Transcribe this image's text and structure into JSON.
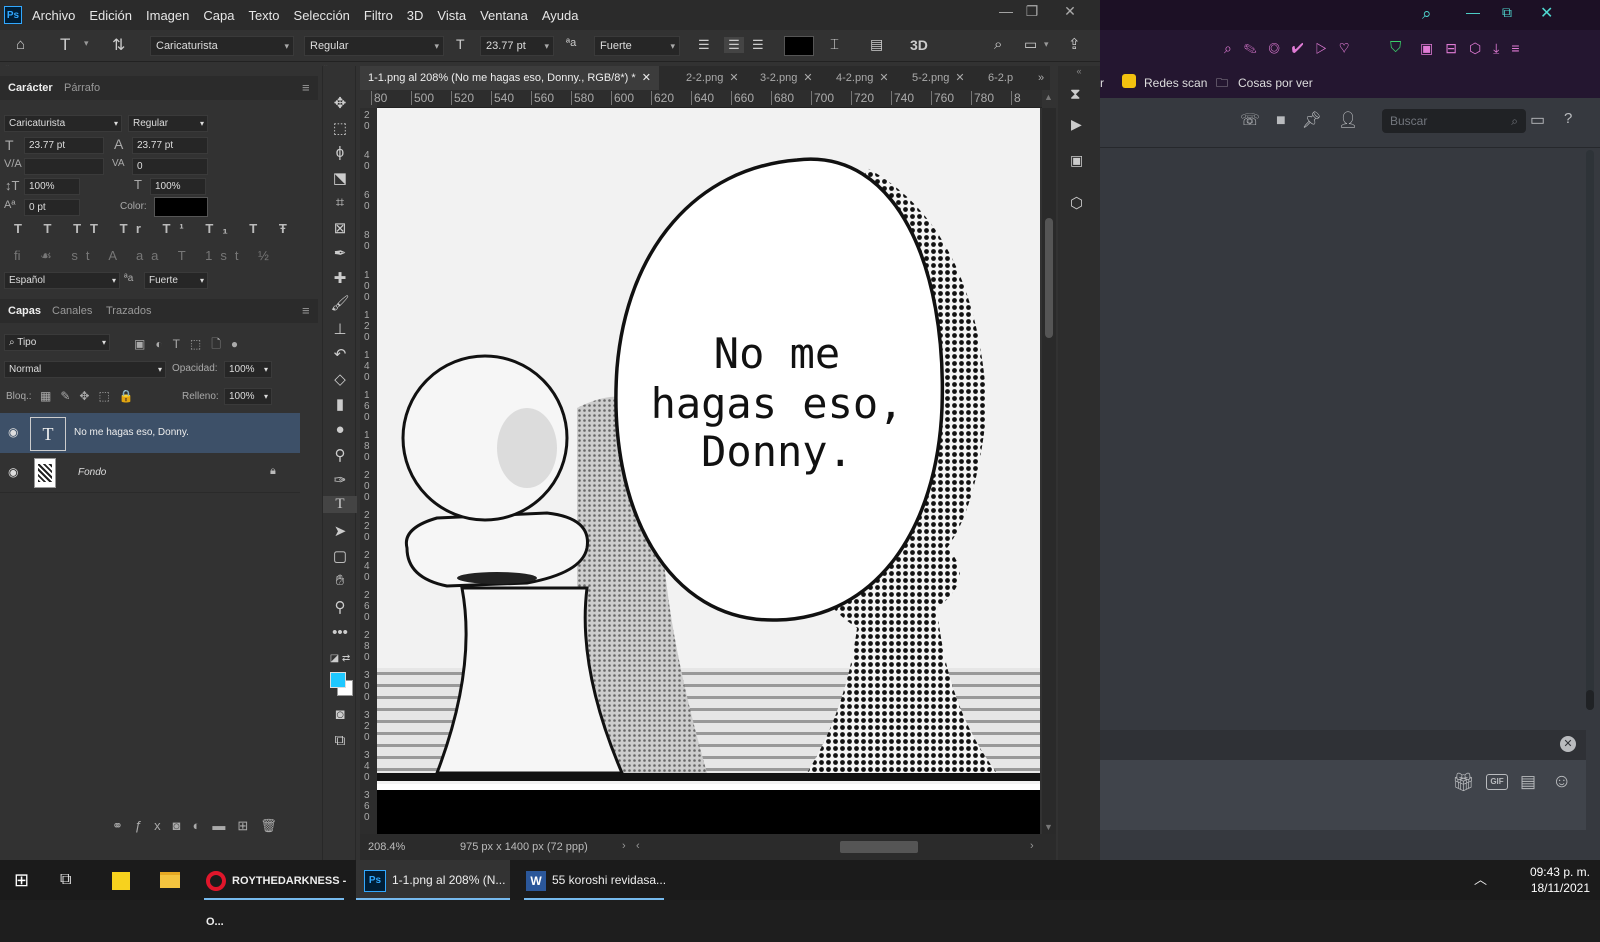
{
  "app": {
    "logo": "Ps",
    "menu": [
      "Archivo",
      "Edición",
      "Imagen",
      "Capa",
      "Texto",
      "Selección",
      "Filtro",
      "3D",
      "Vista",
      "Ventana",
      "Ayuda"
    ]
  },
  "options": {
    "font_family": "Caricaturista",
    "font_style": "Regular",
    "font_size": "23.77 pt",
    "antialias": "Fuerte",
    "three_d": "3D"
  },
  "character_panel": {
    "tabs": [
      "Carácter",
      "Párrafo"
    ],
    "font_family": "Caricaturista",
    "font_style": "Regular",
    "size": "23.77 pt",
    "leading": "23.77 pt",
    "kerning": "",
    "tracking": "0",
    "vscale": "100%",
    "hscale": "100%",
    "baseline": "0 pt",
    "color_label": "Color:",
    "language": "Español",
    "antialias": "Fuerte"
  },
  "layers_panel": {
    "tabs": [
      "Capas",
      "Canales",
      "Trazados"
    ],
    "filter": "Tipo",
    "blend_mode": "Normal",
    "opacity_label": "Opacidad:",
    "opacity": "100%",
    "lock_label": "Bloq.:",
    "fill_label": "Relleno:",
    "fill": "100%",
    "layers": [
      {
        "name": "No me hagas eso, Donny.",
        "type": "text",
        "selected": true
      },
      {
        "name": "Fondo",
        "type": "image",
        "locked": true
      }
    ]
  },
  "document": {
    "tabs": [
      {
        "label": "1-1.png al 208% (No me hagas eso, Donny., RGB/8*) *",
        "active": true
      },
      {
        "label": "2-2.png"
      },
      {
        "label": "3-2.png"
      },
      {
        "label": "4-2.png"
      },
      {
        "label": "5-2.png"
      },
      {
        "label": "6-2.p"
      }
    ],
    "ruler_h": [
      "80",
      "500",
      "520",
      "540",
      "560",
      "580",
      "600",
      "620",
      "640",
      "660",
      "680",
      "700",
      "720",
      "740",
      "760",
      "780",
      "8"
    ],
    "ruler_v": [
      "2\n0",
      "4\n0",
      "6\n0",
      "8\n0",
      "1\n0\n0",
      "1\n2\n0",
      "1\n4\n0",
      "1\n6\n0",
      "1\n8\n0",
      "2\n0\n0",
      "2\n2\n0",
      "2\n4\n0",
      "2\n6\n0",
      "2\n8\n0",
      "3\n0\n0",
      "3\n2\n0",
      "3\n4\n0",
      "3\n6\n0"
    ],
    "speech_text": [
      "No me",
      "hagas eso,",
      "Donny."
    ],
    "zoom": "208.4%",
    "dimensions": "975 px x 1400 px (72 ppp)"
  },
  "browser": {
    "bookmarks": [
      "Redes scan",
      "Cosas por ver"
    ],
    "partial_left": "r",
    "search_placeholder": "Buscar",
    "gif_label": "GIF"
  },
  "taskbar": {
    "tasks": [
      {
        "label": "ROYTHEDARKNESS - O..."
      },
      {
        "label": "1-1.png al 208% (N..."
      },
      {
        "label": "55 koroshi revidasa..."
      }
    ],
    "time": "09:43 p. m.",
    "date": "18/11/2021"
  },
  "colors": {
    "accent": "#31a8ff",
    "foreground_swatch": "#1ec8ff"
  }
}
